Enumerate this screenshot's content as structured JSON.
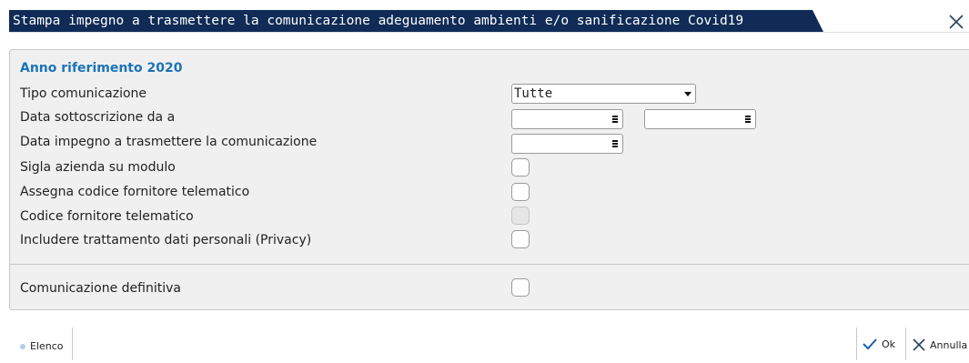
{
  "window": {
    "title": "Stampa impegno a trasmettere la comunicazione adeguamento ambienti e/o sanificazione Covid19",
    "accent_color": "#0f2b56",
    "close_icon": "close-icon"
  },
  "form": {
    "section_title": "Anno riferimento  2020",
    "rows": [
      {
        "label": "Tipo comunicazione"
      },
      {
        "label": "Data sottoscrizione da a"
      },
      {
        "label": "Data impegno a trasmettere la comunicazione"
      },
      {
        "label": "Sigla azienda su modulo"
      },
      {
        "label": "Assegna codice fornitore telematico"
      },
      {
        "label": "Codice fornitore telematico"
      },
      {
        "label": "Includere trattamento dati personali (Privacy)"
      },
      {
        "label": "Comunicazione definitiva"
      }
    ],
    "tipo_comunicazione_value": "Tutte",
    "data_da_value": "",
    "data_a_value": "",
    "data_impegno_value": "",
    "sigla_azienda_checked": false,
    "assegna_codice_checked": false,
    "codice_fornitore_enabled": false,
    "privacy_checked": false,
    "definitiva_checked": false
  },
  "toolbar": {
    "elenco_label": "Elenco",
    "ok_label": "Ok",
    "annulla_label": "Annulla",
    "ok_icon": "check-icon",
    "annulla_icon": "x-icon"
  }
}
